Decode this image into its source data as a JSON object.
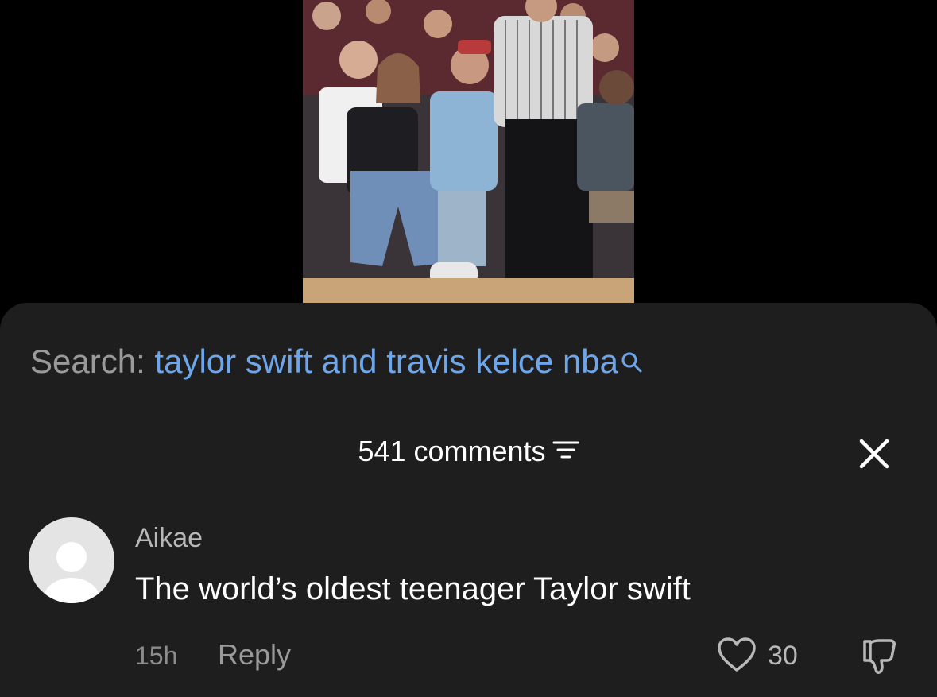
{
  "video": {
    "description_icon": "video-thumbnail"
  },
  "search": {
    "prefix": "Search:",
    "query": "taylor swift and travis kelce nba",
    "icon": "search-icon",
    "query_color": "#6ea6ec"
  },
  "comments_header": {
    "title": "541 comments",
    "filter_icon": "filter-icon",
    "close_icon": "close-icon"
  },
  "comments": [
    {
      "author": "Aikae",
      "text": "The world’s oldest teenager Taylor swift",
      "time": "15h",
      "reply_label": "Reply",
      "likes": "30",
      "like_icon": "heart-icon",
      "dislike_icon": "thumbs-down-icon"
    }
  ],
  "colors": {
    "sheet_background": "#1e1e1e",
    "background": "#000000",
    "accent": "#6ea6ec"
  }
}
